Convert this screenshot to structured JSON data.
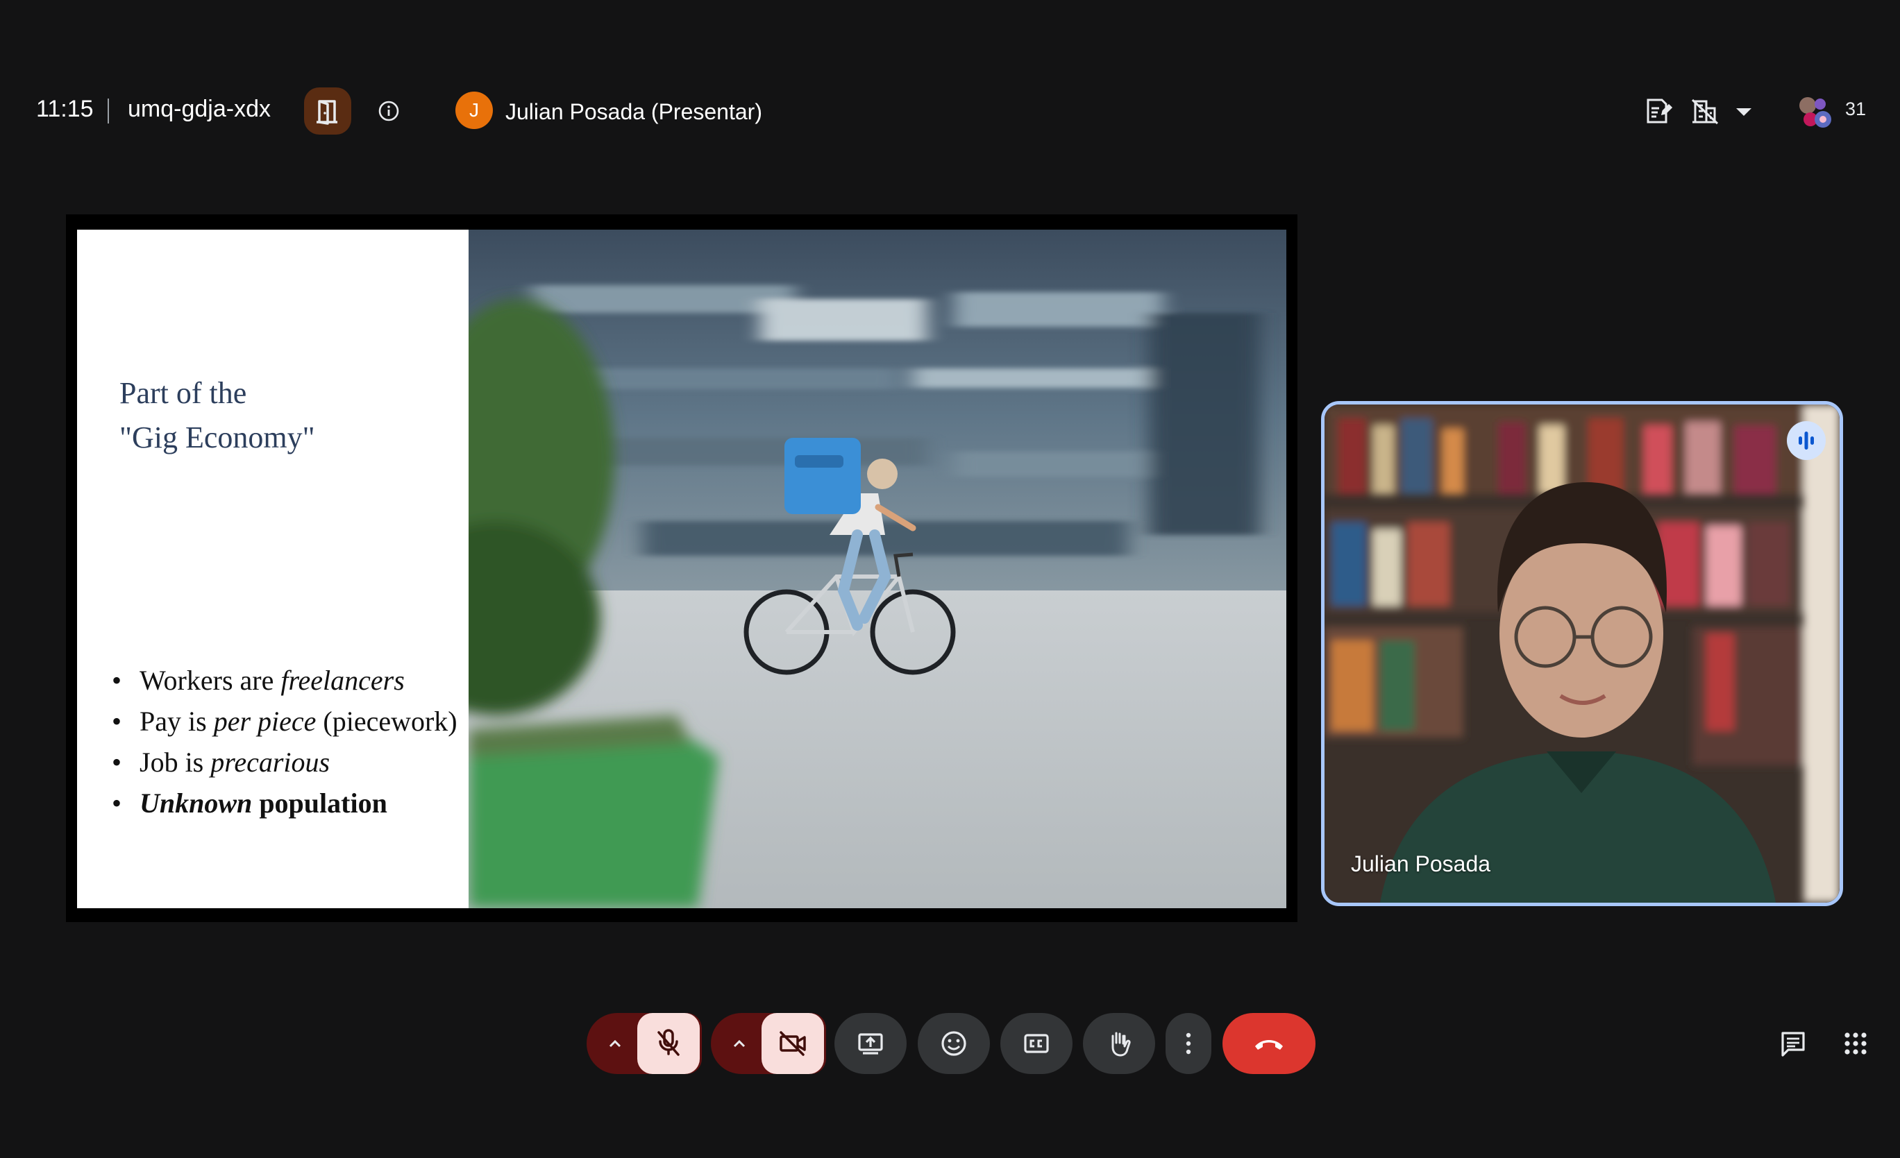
{
  "header": {
    "time": "11:15",
    "meeting_code": "umq-gdja-xdx",
    "presenter_initial": "J",
    "presenter_label": "Julian Posada (Presentar)",
    "participant_count": "31"
  },
  "slide": {
    "title_line1": "Part of the",
    "title_line2": "\"Gig Economy\"",
    "bullets": [
      {
        "plain": "Workers are ",
        "em": "freelancers",
        "rest": ""
      },
      {
        "plain": "Pay is ",
        "em": "per piece",
        "rest": " (piecework)"
      },
      {
        "plain": "Job is ",
        "em": "precarious",
        "rest": ""
      },
      {
        "strong_em": "Unknown",
        "strong": " population"
      }
    ]
  },
  "participant": {
    "name": "Julian Posada"
  },
  "colors": {
    "background": "#131314",
    "presenter_avatar": "#e8710a",
    "muted_control": "#f9dedc",
    "hangup": "#dc362e",
    "tile_border": "#a8c7fa"
  },
  "icons": {
    "room": "door-icon",
    "info": "info-icon",
    "mic": "mic-off-icon",
    "camera": "camera-off-icon",
    "present": "present-screen-icon",
    "reactions": "emoji-icon",
    "captions": "captions-icon",
    "hand": "raise-hand-icon",
    "more": "more-vert-icon",
    "hangup": "call-end-icon",
    "chat": "chat-icon",
    "activities": "apps-grid-icon"
  }
}
